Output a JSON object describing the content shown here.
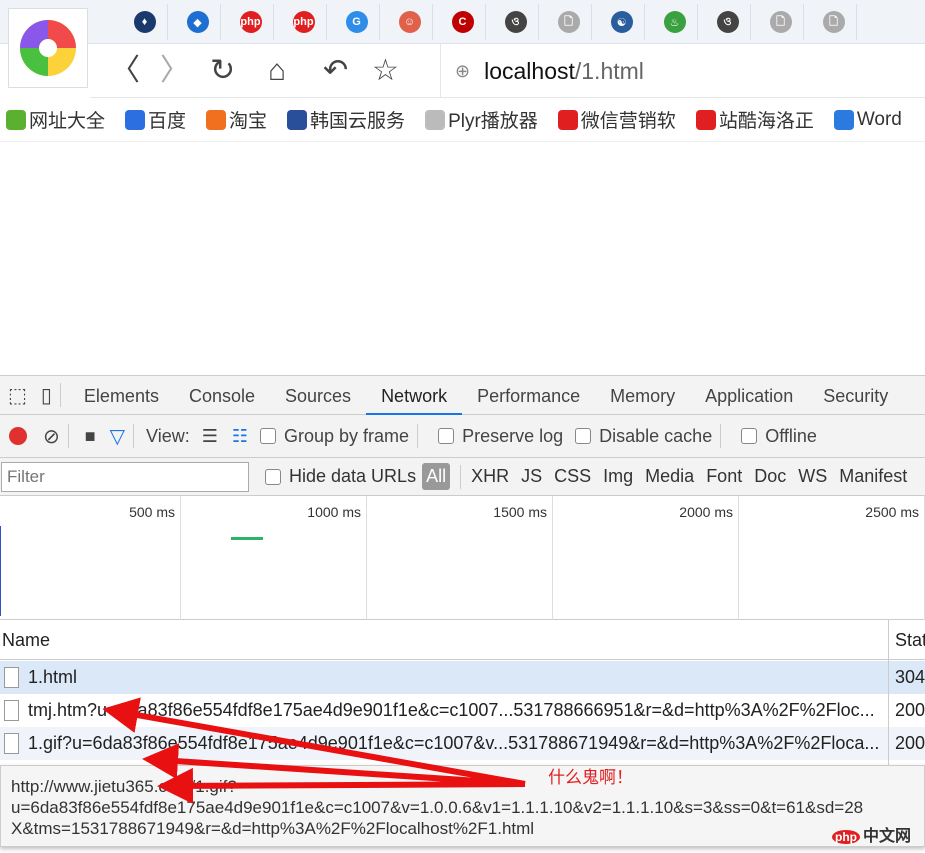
{
  "browser": {
    "tab_icons": [
      {
        "name": "flame-icon",
        "color": "#1a3a6e",
        "glyph": "♦"
      },
      {
        "name": "diamond-icon",
        "color": "#1d6fd1",
        "glyph": "◆"
      },
      {
        "name": "php-icon",
        "color": "#e02020",
        "glyph": "php"
      },
      {
        "name": "php-icon",
        "color": "#e02020",
        "glyph": "php"
      },
      {
        "name": "g-icon",
        "color": "#2e8de8",
        "glyph": "G"
      },
      {
        "name": "circle-icon",
        "color": "#e0604a",
        "glyph": "☺"
      },
      {
        "name": "c-icon",
        "color": "#c00000",
        "glyph": "C"
      },
      {
        "name": "script-icon",
        "color": "#444",
        "glyph": "ও"
      },
      {
        "name": "page-icon",
        "color": "#aaa",
        "glyph": "🗋"
      },
      {
        "name": "app-icon",
        "color": "#2a5d9e",
        "glyph": "☯"
      },
      {
        "name": "green-icon",
        "color": "#3aa040",
        "glyph": "♨"
      },
      {
        "name": "script-icon",
        "color": "#444",
        "glyph": "ও"
      },
      {
        "name": "page-icon",
        "color": "#aaa",
        "glyph": "🗋"
      },
      {
        "name": "page-icon",
        "color": "#aaa",
        "glyph": "🗋"
      }
    ],
    "address_host": "localhost",
    "address_path": "/1.html",
    "bookmarks": [
      {
        "label": "网址大全",
        "color": "#5ab030"
      },
      {
        "label": "百度",
        "color": "#2c6fe0"
      },
      {
        "label": "淘宝",
        "color": "#f07020"
      },
      {
        "label": "韩国云服务",
        "color": "#2a4f9a"
      },
      {
        "label": "Plyr播放器",
        "color": "#bbbbbb"
      },
      {
        "label": "微信营销软",
        "color": "#e02020"
      },
      {
        "label": "站酷海洛正",
        "color": "#e02020"
      },
      {
        "label": "Word",
        "color": "#2a7ae0"
      }
    ]
  },
  "devtools": {
    "tabs": [
      "Elements",
      "Console",
      "Sources",
      "Network",
      "Performance",
      "Memory",
      "Application",
      "Security"
    ],
    "active_tab": "Network",
    "toolbar": {
      "view_label": "View:",
      "group_by_frame": "Group by frame",
      "preserve_log": "Preserve log",
      "disable_cache": "Disable cache",
      "offline": "Offline"
    },
    "filter": {
      "placeholder": "Filter",
      "hide_data_urls": "Hide data URLs",
      "types": [
        "All",
        "XHR",
        "JS",
        "CSS",
        "Img",
        "Media",
        "Font",
        "Doc",
        "WS",
        "Manifest"
      ]
    },
    "timeline_ticks": [
      "500 ms",
      "1000 ms",
      "1500 ms",
      "2000 ms",
      "2500 ms"
    ],
    "columns": {
      "name": "Name",
      "status": "Stat"
    },
    "rows": [
      {
        "name": "1.html",
        "status": "304"
      },
      {
        "name": "tmj.htm?u=6da83f86e554fdf8e175ae4d9e901f1e&c=c1007...531788666951&r=&d=http%3A%2F%2Floc...",
        "status": "200"
      },
      {
        "name": "1.gif?u=6da83f86e554fdf8e175ae4d9e901f1e&c=c1007&v...531788671949&r=&d=http%3A%2F%2Floca...",
        "status": "200"
      }
    ],
    "tooltip": [
      "http://www.jietu365.com/1.gif?",
      "u=6da83f86e554fdf8e175ae4d9e901f1e&c=c1007&v=1.0.0.6&v1=1.1.1.10&v2=1.1.1.10&s=3&ss=0&t=61&sd=28",
      "X&tms=1531788671949&r=&d=http%3A%2F%2Flocalhost%2F1.html"
    ]
  },
  "annotation": "什么鬼啊！",
  "watermark": "中文网",
  "watermark_badge": "php"
}
